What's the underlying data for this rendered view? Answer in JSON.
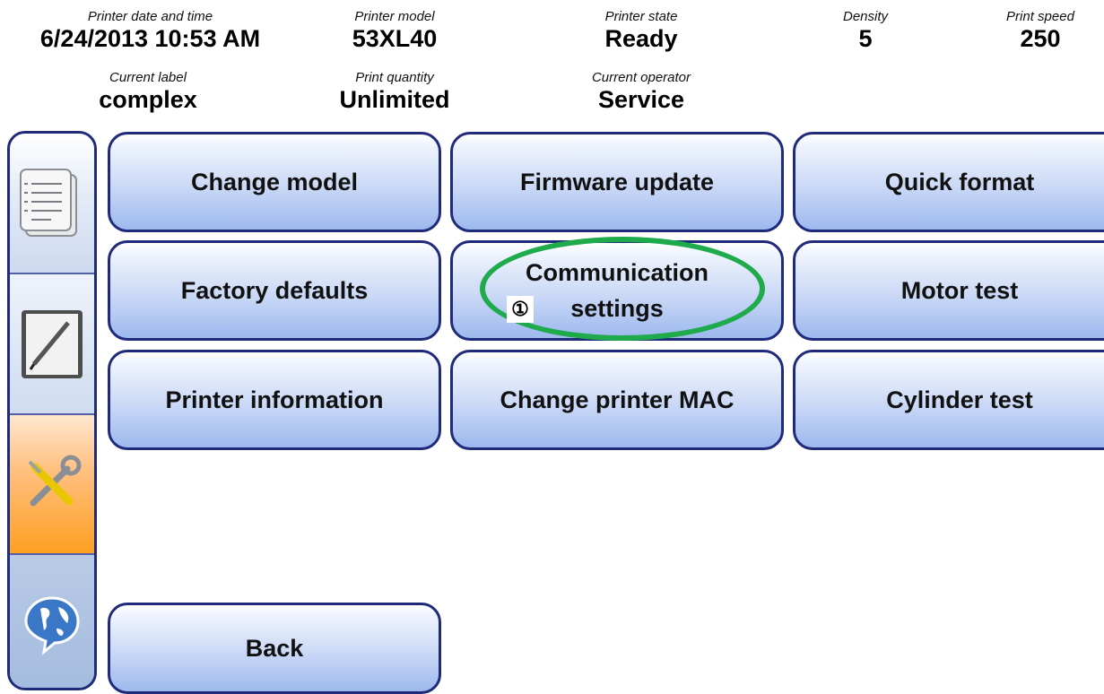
{
  "status": {
    "datetime": {
      "label": "Printer date and time",
      "value": "6/24/2013 10:53 AM"
    },
    "model": {
      "label": "Printer model",
      "value": "53XL40"
    },
    "state": {
      "label": "Printer state",
      "value": "Ready"
    },
    "density": {
      "label": "Density",
      "value": "5"
    },
    "speed": {
      "label": "Print speed",
      "value": "250"
    },
    "current_label": {
      "label": "Current label",
      "value": "complex"
    },
    "quantity": {
      "label": "Print quantity",
      "value": "Unlimited"
    },
    "operator": {
      "label": "Current operator",
      "value": "Service"
    }
  },
  "sidebar": {
    "items": [
      {
        "icon": "documents-icon",
        "active": false
      },
      {
        "icon": "edit-pen-icon",
        "active": false
      },
      {
        "icon": "tools-icon",
        "active": true,
        "accent": "#ff9f22"
      },
      {
        "icon": "globe-chat-icon",
        "active": false
      }
    ]
  },
  "buttons": {
    "change_model": "Change model",
    "firmware_update": "Firmware update",
    "quick_format": "Quick format",
    "factory_defaults": "Factory defaults",
    "communication_settings_line1": "Communication",
    "communication_settings_line2": "settings",
    "motor_test": "Motor test",
    "printer_information": "Printer information",
    "change_printer_mac": "Change printer MAC",
    "cylinder_test": "Cylinder test",
    "back": "Back"
  },
  "annotation": {
    "marker": "①",
    "highlight_color": "#1faa4b"
  }
}
